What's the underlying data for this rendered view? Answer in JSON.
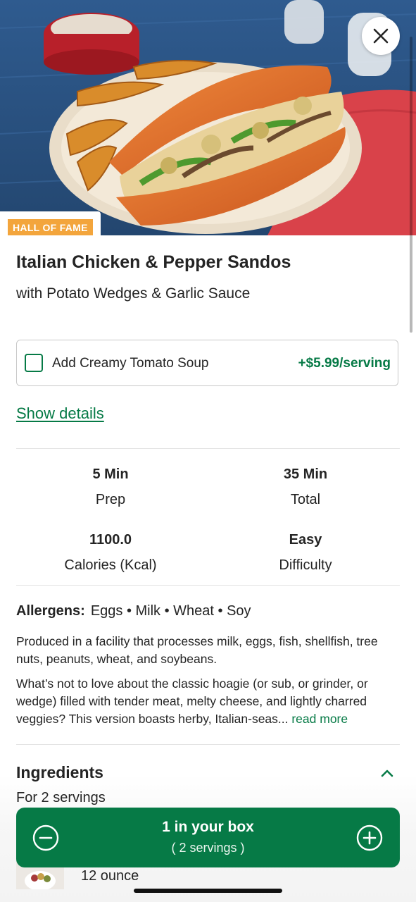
{
  "hero": {
    "image_alt": "Italian Chicken and Pepper Sando with potato wedges"
  },
  "badge": "HALL OF FAME",
  "recipe": {
    "title": "Italian Chicken & Pepper Sandos",
    "subtitle": "with Potato Wedges & Garlic Sauce"
  },
  "addon": {
    "label": "Add Creamy Tomato Soup",
    "price": "+$5.99/serving",
    "checked": false
  },
  "show_details": "Show details",
  "stats": [
    {
      "value": "5 Min",
      "label": "Prep"
    },
    {
      "value": "35 Min",
      "label": "Total"
    },
    {
      "value": "1100.0",
      "label": "Calories (Kcal)"
    },
    {
      "value": "Easy",
      "label": "Difficulty"
    }
  ],
  "allergens": {
    "label": "Allergens:",
    "items": "Eggs • Milk • Wheat • Soy"
  },
  "facility_note": "Produced in a facility that processes milk, eggs, fish, shellfish, tree nuts, peanuts, wheat, and soybeans.",
  "description": {
    "text": "What’s not to love about the classic hoagie (or sub, or grinder, or wedge) filled with tender meat, melty cheese, and lightly charred veggies? This version boasts herby, Italian-seas... ",
    "read_more": "read more"
  },
  "ingredients": {
    "title": "Ingredients",
    "servings": "For 2 servings",
    "first_item_qty": "12 ounce"
  },
  "cart": {
    "count_text": "1 in your box",
    "servings_text": "( 2 servings )"
  },
  "colors": {
    "brand_green": "#067a46",
    "badge_orange": "#f3a53c"
  },
  "icons": {
    "close": "close-icon",
    "minus": "minus-circle-icon",
    "plus": "plus-circle-icon",
    "collapse": "chevron-up-icon"
  }
}
